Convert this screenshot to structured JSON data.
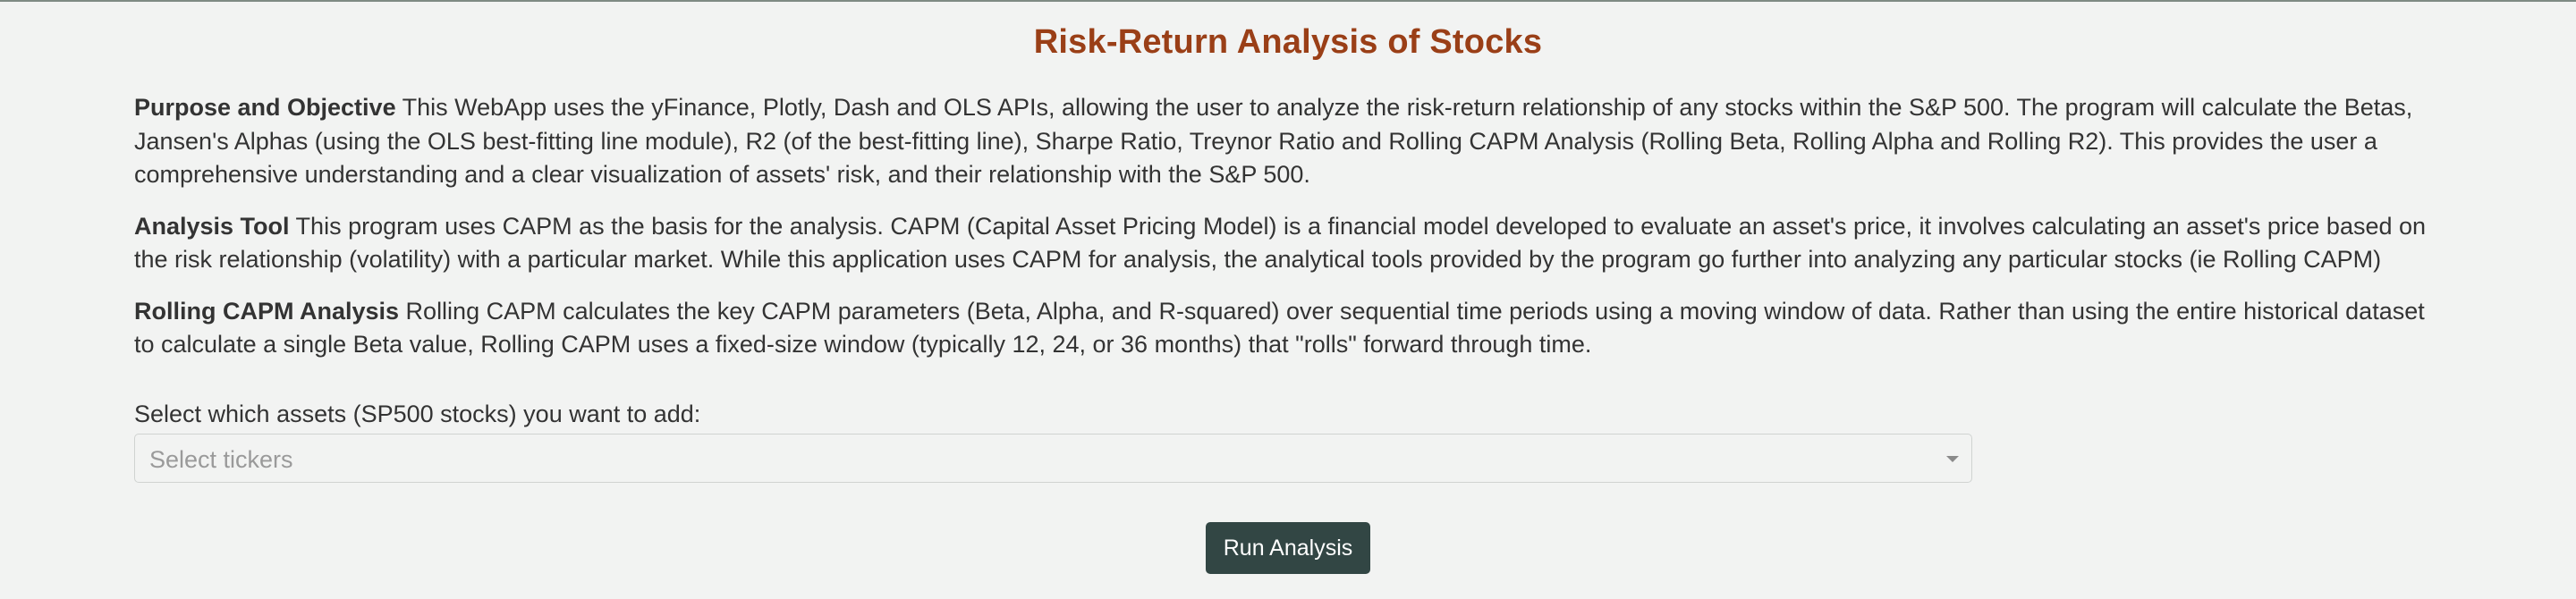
{
  "header": {
    "title": "Risk-Return Analysis of Stocks"
  },
  "sections": [
    {
      "lead": "Purpose and Objective",
      "text": " This WebApp uses the yFinance, Plotly, Dash and OLS APIs, allowing the user to analyze the risk-return relationship of any stocks within the S&P 500. The program will calculate the Betas, Jansen's Alphas (using the OLS best-fitting line module), R2 (of the best-fitting line), Sharpe Ratio, Treynor Ratio and Rolling CAPM Analysis (Rolling Beta, Rolling Alpha and Rolling R2). This provides the user a comprehensive understanding and a clear visualization of assets' risk, and their relationship with the S&P 500."
    },
    {
      "lead": "Analysis Tool",
      "text": " This program uses CAPM as the basis for the analysis. CAPM (Capital Asset Pricing Model) is a financial model developed to evaluate an asset's price, it involves calculating an asset's price based on the risk relationship (volatility) with a particular market. While this application uses CAPM for analysis, the analytical tools provided by the program go further into analyzing any particular stocks (ie Rolling CAPM)"
    },
    {
      "lead": "Rolling CAPM Analysis",
      "text": " Rolling CAPM calculates the key CAPM parameters (Beta, Alpha, and R-squared) over sequential time periods using a moving window of data. Rather than using the entire historical dataset to calculate a single Beta value, Rolling CAPM uses a fixed-size window (typically 12, 24, or 36 months) that \"rolls\" forward through time."
    }
  ],
  "selector": {
    "label": "Select which assets (SP500 stocks) you want to add:",
    "placeholder": "Select tickers",
    "icon": "chevron-down-icon"
  },
  "actions": {
    "run_label": "Run Analysis",
    "button_color": "#324644"
  },
  "colors": {
    "title": "#9a3f17",
    "background": "#f2f3f2"
  }
}
